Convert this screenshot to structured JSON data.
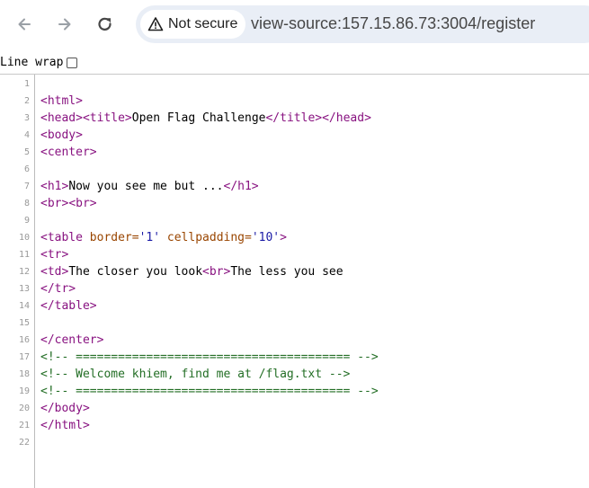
{
  "browser": {
    "security_label": "Not secure",
    "url": "view-source:157.15.86.73:3004/register",
    "icons": {
      "back": "back-arrow-icon",
      "forward": "forward-arrow-icon",
      "reload": "reload-icon",
      "warning": "warning-triangle-icon"
    }
  },
  "line_wrap": {
    "label": "Line wrap",
    "checked": false
  },
  "source": {
    "lines": [
      {
        "n": "1",
        "segments": []
      },
      {
        "n": "2",
        "segments": [
          {
            "t": "tag",
            "v": "<html>"
          }
        ]
      },
      {
        "n": "3",
        "segments": [
          {
            "t": "tag",
            "v": "<head>"
          },
          {
            "t": "tag",
            "v": "<title>"
          },
          {
            "t": "txt",
            "v": "Open Flag Challenge"
          },
          {
            "t": "tag",
            "v": "</title>"
          },
          {
            "t": "tag",
            "v": "</head>"
          }
        ]
      },
      {
        "n": "4",
        "segments": [
          {
            "t": "tag",
            "v": "<body>"
          }
        ]
      },
      {
        "n": "5",
        "segments": [
          {
            "t": "tag",
            "v": "<center>"
          }
        ]
      },
      {
        "n": "6",
        "segments": []
      },
      {
        "n": "7",
        "segments": [
          {
            "t": "tag",
            "v": "<h1>"
          },
          {
            "t": "txt",
            "v": "Now you see me but ..."
          },
          {
            "t": "tag",
            "v": "</h1>"
          }
        ]
      },
      {
        "n": "8",
        "segments": [
          {
            "t": "tag",
            "v": "<br>"
          },
          {
            "t": "tag",
            "v": "<br>"
          }
        ]
      },
      {
        "n": "9",
        "segments": []
      },
      {
        "n": "10",
        "segments": [
          {
            "t": "tag",
            "v": "<table "
          },
          {
            "t": "an",
            "v": "border="
          },
          {
            "t": "av",
            "v": "'1'"
          },
          {
            "t": "tag",
            "v": " "
          },
          {
            "t": "an",
            "v": "cellpadding="
          },
          {
            "t": "av",
            "v": "'10'"
          },
          {
            "t": "tag",
            "v": ">"
          }
        ]
      },
      {
        "n": "11",
        "segments": [
          {
            "t": "tag",
            "v": "<tr>"
          }
        ]
      },
      {
        "n": "12",
        "segments": [
          {
            "t": "tag",
            "v": "<td>"
          },
          {
            "t": "txt",
            "v": "The closer you look"
          },
          {
            "t": "tag",
            "v": "<br>"
          },
          {
            "t": "txt",
            "v": "The less you see"
          }
        ]
      },
      {
        "n": "13",
        "segments": [
          {
            "t": "tag",
            "v": "</tr>"
          }
        ]
      },
      {
        "n": "14",
        "segments": [
          {
            "t": "tag",
            "v": "</table>"
          }
        ]
      },
      {
        "n": "15",
        "segments": []
      },
      {
        "n": "16",
        "segments": [
          {
            "t": "tag",
            "v": "</center>"
          }
        ]
      },
      {
        "n": "17",
        "segments": [
          {
            "t": "cm",
            "v": "<!-- ======================================= -->"
          }
        ]
      },
      {
        "n": "18",
        "segments": [
          {
            "t": "cm",
            "v": "<!-- Welcome khiem, find me at /flag.txt -->"
          }
        ]
      },
      {
        "n": "19",
        "segments": [
          {
            "t": "cm",
            "v": "<!-- ======================================= -->"
          }
        ]
      },
      {
        "n": "20",
        "segments": [
          {
            "t": "tag",
            "v": "</body>"
          }
        ]
      },
      {
        "n": "21",
        "segments": [
          {
            "t": "tag",
            "v": "</html>"
          }
        ]
      },
      {
        "n": "22",
        "segments": []
      }
    ]
  }
}
